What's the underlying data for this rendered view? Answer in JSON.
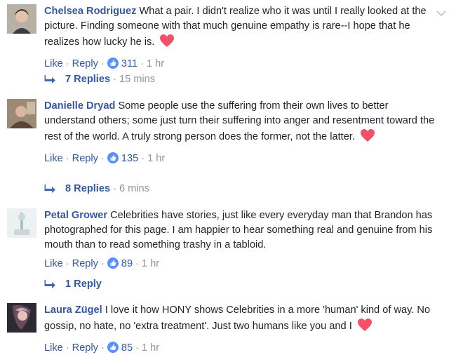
{
  "comments": [
    {
      "author": "Chelsea Rodriguez",
      "text": "What a pair. I didn't realize who it was until I really looked at the picture. Finding someone with that much genuine empathy is rare--I hope that he realizes how lucky he is.",
      "like_label": "Like",
      "reply_label": "Reply",
      "reaction_count": "311",
      "time": "1 hr",
      "replies_label": "7 Replies",
      "replies_time": "15 mins"
    },
    {
      "author": "Danielle Dryad",
      "text": "Some people use the suffering from their own lives to better understand others; some just turn their suffering into anger and resentment toward the rest of the world. A truly strong person does the former, not the latter.",
      "like_label": "Like",
      "reply_label": "Reply",
      "reaction_count": "135",
      "time": "1 hr",
      "replies_label": "8 Replies",
      "replies_time": "6 mins"
    },
    {
      "author": "Petal Grower",
      "text": "Celebrities have stories, just like every everyday man that Brandon has photographed for this page. I am happier to hear something real and genuine from his mouth than to read something trashy in a tabloid.",
      "like_label": "Like",
      "reply_label": "Reply",
      "reaction_count": "89",
      "time": "1 hr",
      "replies_label": "1 Reply",
      "replies_time": ""
    },
    {
      "author": "Laura Zügel",
      "text": "I love it how HONY shows Celebrities in a more 'human' kind of way. No gossip, no hate, no 'extra treatment'. Just two humans like you and I",
      "like_label": "Like",
      "reply_label": "Reply",
      "reaction_count": "85",
      "time": "1 hr"
    }
  ],
  "separator": "·",
  "icons": {
    "reaction": "like-thumb-icon",
    "heart": "heart-icon",
    "reply_arrow": "reply-arrow-icon",
    "chevron": "chevron-down-icon"
  },
  "colors": {
    "link": "#365899",
    "meta": "#90949c",
    "like_badge": "#5890ff",
    "heart": "#f25268"
  }
}
